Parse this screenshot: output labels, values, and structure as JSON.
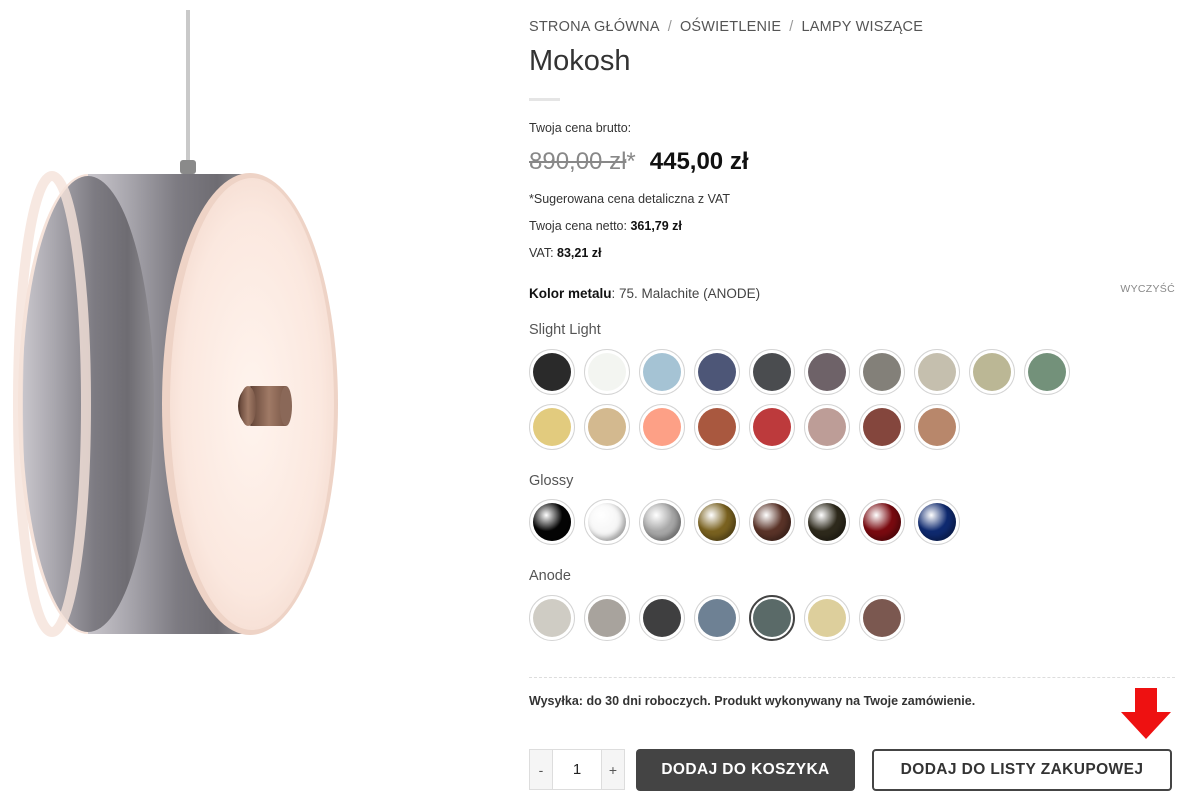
{
  "breadcrumb": {
    "home": "STRONA GŁÓWNA",
    "category": "OŚWIETLENIE",
    "subcategory": "LAMPY WISZĄCE",
    "separator": "/"
  },
  "product": {
    "title": "Mokosh",
    "image_alt": "Mokosh pendant lamp"
  },
  "price": {
    "label": "Twoja cena brutto:",
    "old": "890,00 zł",
    "asterisk": "*",
    "new": "445,00 zł",
    "note": "*Sugerowana cena detaliczna z VAT",
    "net_label": "Twoja cena netto:",
    "net_value": "361,79 zł",
    "vat_label": "VAT:",
    "vat_value": "83,21 zł"
  },
  "color": {
    "label": "Kolor metalu",
    "selected": "75. Malachite (ANODE)",
    "clear": "WYCZYŚĆ",
    "groups": [
      {
        "name": "Slight Light",
        "swatches": [
          "#2a2a2a",
          "#f3f5f1",
          "#a5c3d4",
          "#4d5677",
          "#4a4c4f",
          "#6e6268",
          "#838079",
          "#c5bfae",
          "#bbb795",
          "#73917a",
          "#e2cb7e",
          "#d3b98f",
          "#fda086",
          "#a9583f",
          "#bd3a3c",
          "#bd9d97",
          "#84463d",
          "#b8876b"
        ]
      },
      {
        "name": "Glossy",
        "swatches": [
          "#050505",
          "#f7f7f7",
          "#a8a8a8",
          "#7a6220",
          "#5a3328",
          "#2e2a1c",
          "#7a0a10",
          "#0f2a70"
        ]
      },
      {
        "name": "Anode",
        "swatches": [
          "#cfccc4",
          "#a8a39d",
          "#3f3f40",
          "#6e8194",
          "#5a6a68",
          "#ddcf9c",
          "#7b5850"
        ],
        "selected_index": 4
      }
    ]
  },
  "shipping": "Wysyłka: do 30 dni roboczych. Produkt wykonywany na Twoje zamówienie.",
  "quantity": {
    "minus": "-",
    "value": "1",
    "plus": "+"
  },
  "buttons": {
    "add_to_cart": "DODAJ DO KOSZYKA",
    "add_to_list": "DODAJ DO LISTY ZAKUPOWEJ"
  },
  "accent_colors": {
    "arrow": "#ee1111",
    "dark_button": "#444444"
  }
}
